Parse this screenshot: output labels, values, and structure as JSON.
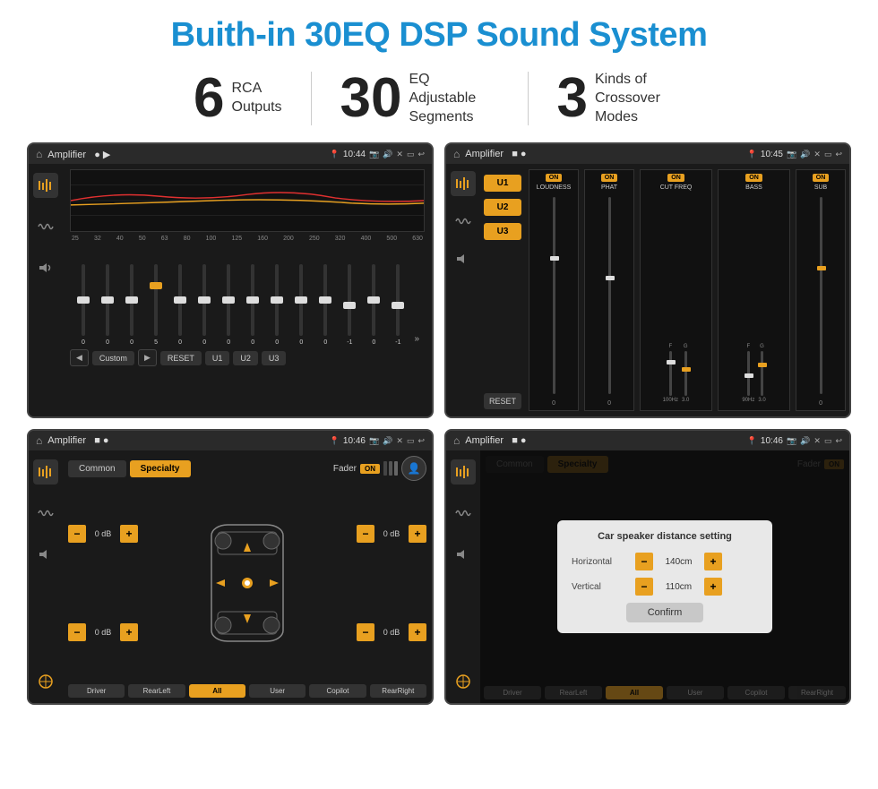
{
  "page": {
    "title": "Buith-in 30EQ DSP Sound System",
    "title_color": "#1a8fd1"
  },
  "stats": [
    {
      "number": "6",
      "label": "RCA\nOutputs"
    },
    {
      "number": "30",
      "label": "EQ Adjustable\nSegments"
    },
    {
      "number": "3",
      "label": "Kinds of\nCrossover Modes"
    }
  ],
  "screens": [
    {
      "id": "screen1",
      "status_bar": {
        "title": "Amplifier",
        "time": "10:44"
      },
      "eq_frequencies": [
        "25",
        "32",
        "40",
        "50",
        "63",
        "80",
        "100",
        "125",
        "160",
        "200",
        "250",
        "320",
        "400",
        "500",
        "630"
      ],
      "eq_values": [
        "0",
        "0",
        "0",
        "5",
        "0",
        "0",
        "0",
        "0",
        "0",
        "0",
        "0",
        "-1",
        "0",
        "-1"
      ],
      "bottom_buttons": [
        "Custom",
        "RESET",
        "U1",
        "U2",
        "U3"
      ]
    },
    {
      "id": "screen2",
      "status_bar": {
        "title": "Amplifier",
        "time": "10:45"
      },
      "u_buttons": [
        "U1",
        "U2",
        "U3"
      ],
      "channels": [
        {
          "label": "LOUDNESS",
          "on": true
        },
        {
          "label": "PHAT",
          "on": true
        },
        {
          "label": "CUT FREQ",
          "on": true
        },
        {
          "label": "BASS",
          "on": true
        },
        {
          "label": "SUB",
          "on": true
        }
      ],
      "reset_label": "RESET"
    },
    {
      "id": "screen3",
      "status_bar": {
        "title": "Amplifier",
        "time": "10:46"
      },
      "tabs": [
        "Common",
        "Specialty"
      ],
      "active_tab": "Specialty",
      "fader_label": "Fader",
      "fader_on": "ON",
      "db_values": [
        "0 dB",
        "0 dB",
        "0 dB",
        "0 dB"
      ],
      "bottom_buttons": [
        "Driver",
        "RearLeft",
        "All",
        "User",
        "Copilot",
        "RearRight"
      ]
    },
    {
      "id": "screen4",
      "status_bar": {
        "title": "Amplifier",
        "time": "10:46"
      },
      "tabs": [
        "Common",
        "Specialty"
      ],
      "dialog": {
        "title": "Car speaker distance setting",
        "rows": [
          {
            "label": "Horizontal",
            "value": "140cm"
          },
          {
            "label": "Vertical",
            "value": "110cm"
          }
        ],
        "confirm_label": "Confirm"
      },
      "bottom_buttons": [
        "Driver",
        "RearLeft",
        "All",
        "User",
        "Copilot",
        "RearRight"
      ]
    }
  ]
}
